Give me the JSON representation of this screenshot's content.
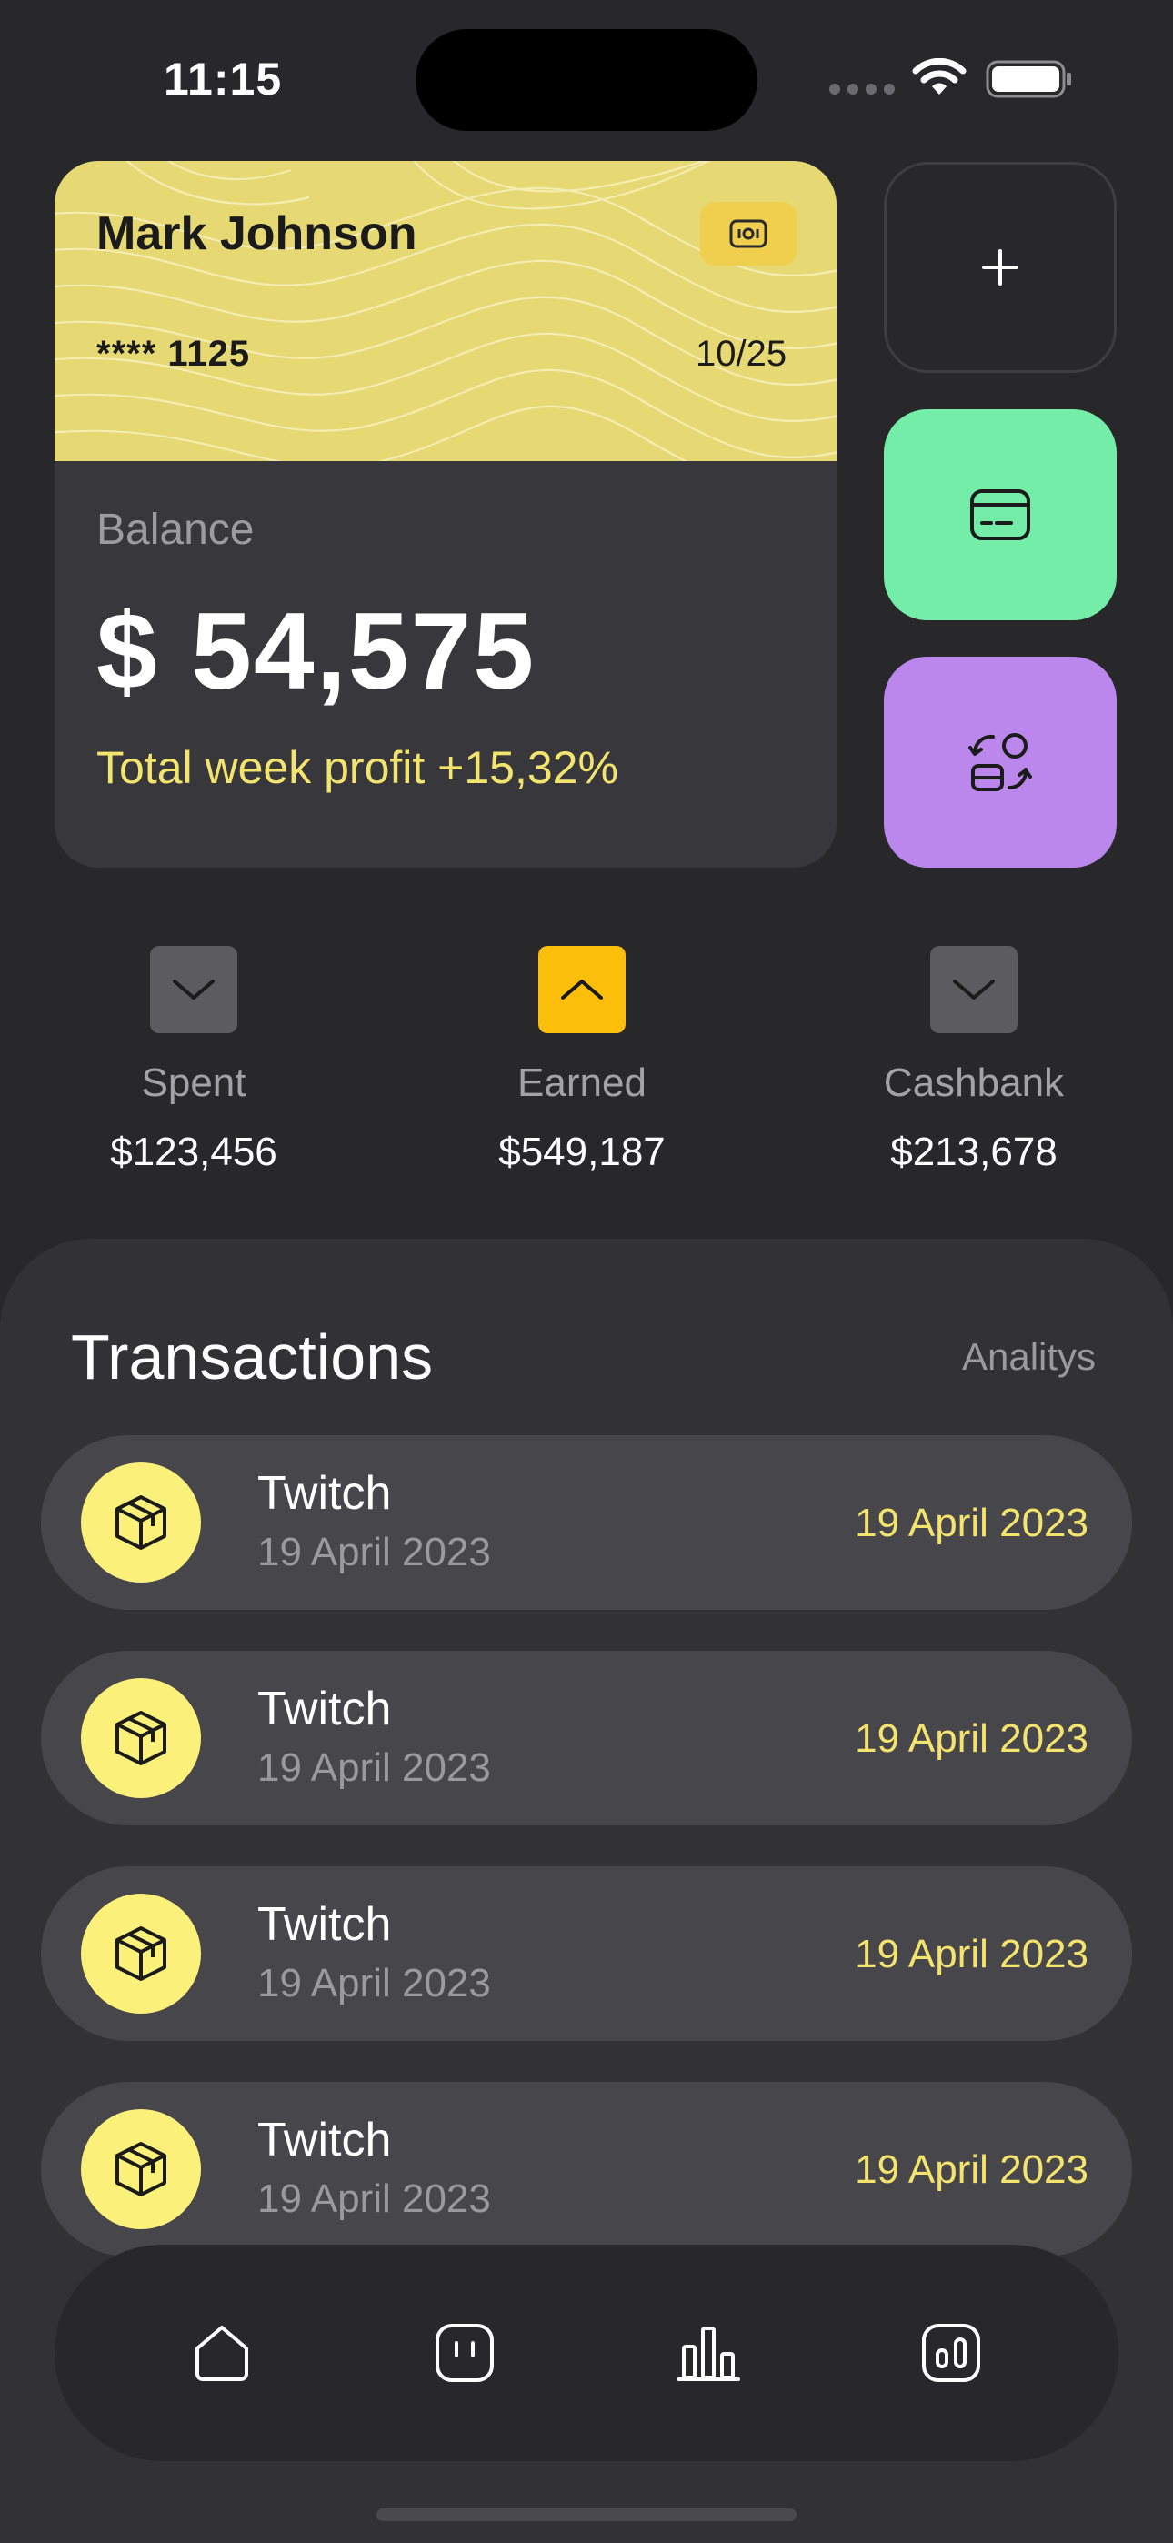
{
  "status_bar": {
    "time": "11:15"
  },
  "card": {
    "holder": "Mark Johnson",
    "number": "**** 1125",
    "expiry": "10/25",
    "color": "#e6d873"
  },
  "balance": {
    "label": "Balance",
    "value": "$ 54,575",
    "profit": "Total week profit +15,32%"
  },
  "side_actions": [
    {
      "icon": "plus-icon",
      "color": "#28282b"
    },
    {
      "icon": "card-icon",
      "color": "#74eda9"
    },
    {
      "icon": "exchange-icon",
      "color": "#bb87ec"
    }
  ],
  "stats": [
    {
      "label": "Spent",
      "value": "$123,456",
      "icon": "chevron-down-icon"
    },
    {
      "label": "Earned",
      "value": "$549,187",
      "icon": "chevron-up-icon",
      "accent": "#fbbf0b"
    },
    {
      "label": "Cashbank",
      "value": "$213,678",
      "icon": "chevron-down-icon"
    }
  ],
  "transactions": {
    "title": "Transactions",
    "link": "Analitys",
    "items": [
      {
        "name": "Twitch",
        "subtitle": "19 April 2023",
        "date": "19 April 2023",
        "icon": "package-icon"
      },
      {
        "name": "Twitch",
        "subtitle": "19 April 2023",
        "date": "19 April 2023",
        "icon": "package-icon"
      },
      {
        "name": "Twitch",
        "subtitle": "19 April 2023",
        "date": "19 April 2023",
        "icon": "package-icon"
      },
      {
        "name": "Twitch",
        "subtitle": "19 April 2023",
        "date": "19 April 2023",
        "icon": "package-icon"
      }
    ]
  },
  "nav": [
    "home-icon",
    "wallet-icon",
    "chart-icon",
    "stats-icon"
  ]
}
